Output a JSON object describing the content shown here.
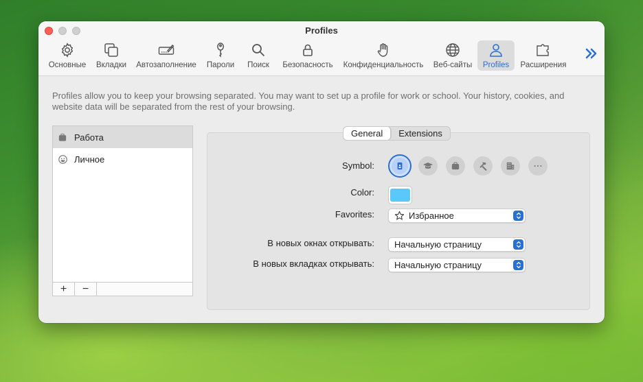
{
  "window": {
    "title": "Profiles"
  },
  "toolbar": {
    "items": [
      {
        "label": "Основные",
        "icon": "gear-icon"
      },
      {
        "label": "Вкладки",
        "icon": "tabs-icon"
      },
      {
        "label": "Автозаполнение",
        "icon": "autofill-icon"
      },
      {
        "label": "Пароли",
        "icon": "key-icon"
      },
      {
        "label": "Поиск",
        "icon": "search-icon"
      },
      {
        "label": "Безопасность",
        "icon": "lock-icon"
      },
      {
        "label": "Конфиденциальность",
        "icon": "hand-icon"
      },
      {
        "label": "Веб-сайты",
        "icon": "globe-icon"
      },
      {
        "label": "Profiles",
        "icon": "person-icon",
        "active": true
      },
      {
        "label": "Расширения",
        "icon": "puzzle-icon"
      }
    ],
    "more_icon": "chevron-double-right-icon"
  },
  "description": "Profiles allow you to keep your browsing separated. You may want to set up a profile for work or school. Your history, cookies, and website data will be separated from the rest of your browsing.",
  "profiles": [
    {
      "name": "Работа",
      "icon": "briefcase-icon",
      "selected": true
    },
    {
      "name": "Личное",
      "icon": "smiley-icon",
      "selected": false
    }
  ],
  "list_controls": {
    "add": "+",
    "remove": "−"
  },
  "tabs": {
    "general": "General",
    "extensions": "Extensions",
    "active": "General"
  },
  "form": {
    "symbol_label": "Symbol:",
    "symbols": [
      "id-badge-icon",
      "graduation-cap-icon",
      "briefcase-icon",
      "hammer-icon",
      "building-icon",
      "ellipsis-icon"
    ],
    "color_label": "Color:",
    "color_value": "#5ac8fa",
    "favorites_label": "Favorites:",
    "favorites_value": "Избранное",
    "new_windows_label": "В новых окнах открывать:",
    "new_windows_value": "Начальную страницу",
    "new_tabs_label": "В новых вкладках открывать:",
    "new_tabs_value": "Начальную страницу"
  },
  "colors": {
    "accent": "#2a6fd6",
    "close": "#ff5f57"
  }
}
